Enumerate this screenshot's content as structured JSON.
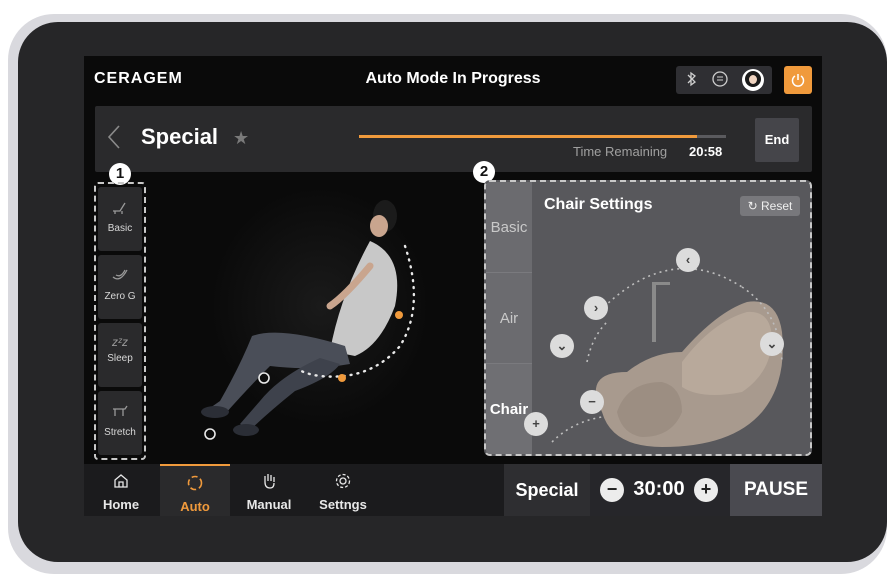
{
  "header": {
    "brand": "CERAGEM",
    "title": "Auto Mode In Progress",
    "status_icons": [
      "bluetooth-icon",
      "chat-icon",
      "avatar",
      "power-icon"
    ]
  },
  "mode_bar": {
    "mode_name": "Special",
    "progress_fraction": 0.92,
    "time_remaining_label": "Time Remaining",
    "time_remaining_value": "20:58",
    "end_label": "End"
  },
  "markers": {
    "presets_badge": "1",
    "settings_badge": "2"
  },
  "presets": [
    {
      "label": "Basic",
      "icon": "chair-basic-icon"
    },
    {
      "label": "Zero G",
      "icon": "zero-g-icon"
    },
    {
      "label": "Sleep",
      "icon": "sleep-icon"
    },
    {
      "label": "Stretch",
      "icon": "stretch-icon"
    }
  ],
  "chair_settings": {
    "title": "Chair Settings",
    "reset_label": "Reset",
    "tabs": [
      "Basic",
      "Air",
      "Chair"
    ],
    "active_tab": "Chair"
  },
  "bottom_nav": {
    "items": [
      {
        "label": "Home",
        "icon": "home-icon"
      },
      {
        "label": "Auto",
        "icon": "auto-icon"
      },
      {
        "label": "Manual",
        "icon": "hand-icon"
      },
      {
        "label": "Settngs",
        "icon": "gear-icon"
      }
    ],
    "active": "Auto",
    "special_label": "Special",
    "timer_value": "30:00",
    "pause_label": "PAUSE"
  },
  "colors": {
    "accent": "#f09a3c",
    "screen_bg": "#0a0a0a",
    "panel": "#2a2a2c"
  }
}
